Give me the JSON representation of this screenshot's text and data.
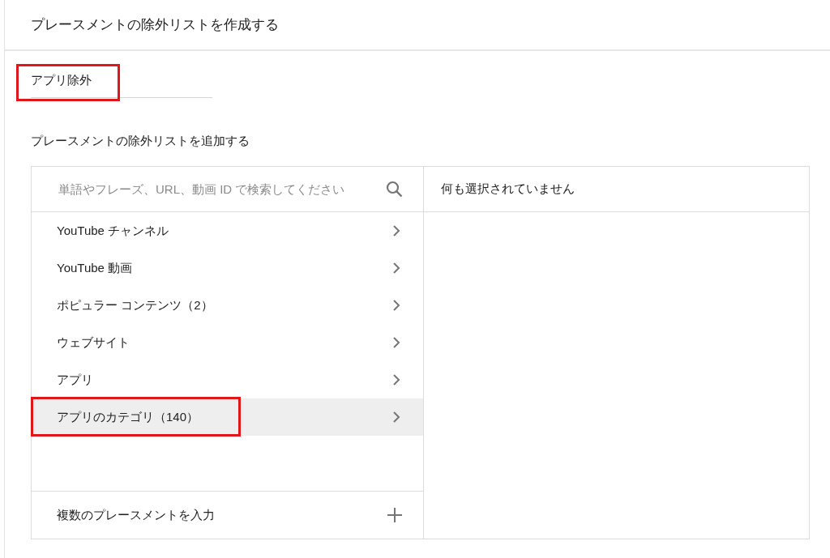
{
  "title": "プレースメントの除外リストを作成する",
  "name_field": {
    "value": "アプリ除外",
    "highlighted": true
  },
  "section_label": "プレースメントの除外リストを追加する",
  "search": {
    "placeholder": "単語やフレーズ、URL、動画 ID で検索してください"
  },
  "categories": [
    {
      "label": "YouTube チャンネル",
      "selected": false,
      "highlighted": false
    },
    {
      "label": "YouTube 動画",
      "selected": false,
      "highlighted": false
    },
    {
      "label": "ポピュラー コンテンツ（2）",
      "selected": false,
      "highlighted": false
    },
    {
      "label": "ウェブサイト",
      "selected": false,
      "highlighted": false
    },
    {
      "label": "アプリ",
      "selected": false,
      "highlighted": false
    },
    {
      "label": "アプリのカテゴリ（140）",
      "selected": true,
      "highlighted": true
    }
  ],
  "add_multiple": {
    "label": "複数のプレースメントを入力"
  },
  "selection_panel": {
    "empty_message": "何も選択されていません"
  }
}
